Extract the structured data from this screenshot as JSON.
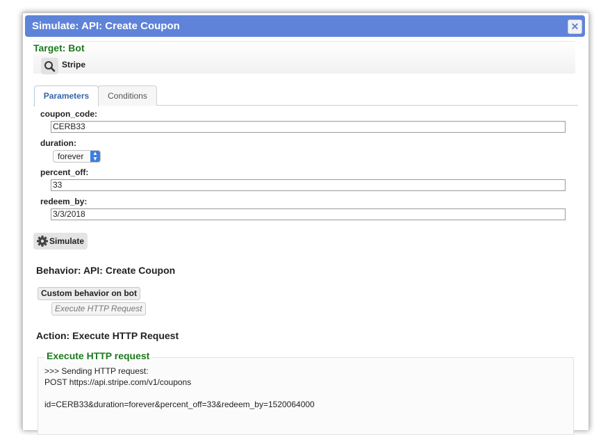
{
  "dialog": {
    "title": "Simulate: API: Create Coupon",
    "close_label": "✕"
  },
  "target": {
    "legend": "Target: Bot",
    "name": "Stripe"
  },
  "tabs": [
    {
      "label": "Parameters",
      "active": true
    },
    {
      "label": "Conditions",
      "active": false
    }
  ],
  "params": {
    "coupon_code": {
      "label": "coupon_code:",
      "value": "CERB33"
    },
    "duration": {
      "label": "duration:",
      "value": "forever"
    },
    "percent_off": {
      "label": "percent_off:",
      "value": "33"
    },
    "redeem_by": {
      "label": "redeem_by:",
      "value": "3/3/2018"
    }
  },
  "simulate_label": "Simulate",
  "behavior": {
    "heading": "Behavior: API: Create Coupon",
    "node_label": "Custom behavior on bot",
    "child_label": "Execute HTTP Request"
  },
  "action": {
    "heading": "Action: Execute HTTP Request",
    "legend": "Execute HTTP request",
    "lines": [
      ">>> Sending HTTP request:",
      "POST https://api.stripe.com/v1/coupons",
      "id=CERB33&duration=forever&percent_off=33&redeem_by=1520064000"
    ]
  },
  "colors": {
    "titlebar": "#5e83d9",
    "legend_green": "#1b7a1b",
    "active_tab_text": "#3565a8"
  },
  "icons": [
    "close-icon",
    "search-icon",
    "gear-icon",
    "select-arrows-icon"
  ]
}
